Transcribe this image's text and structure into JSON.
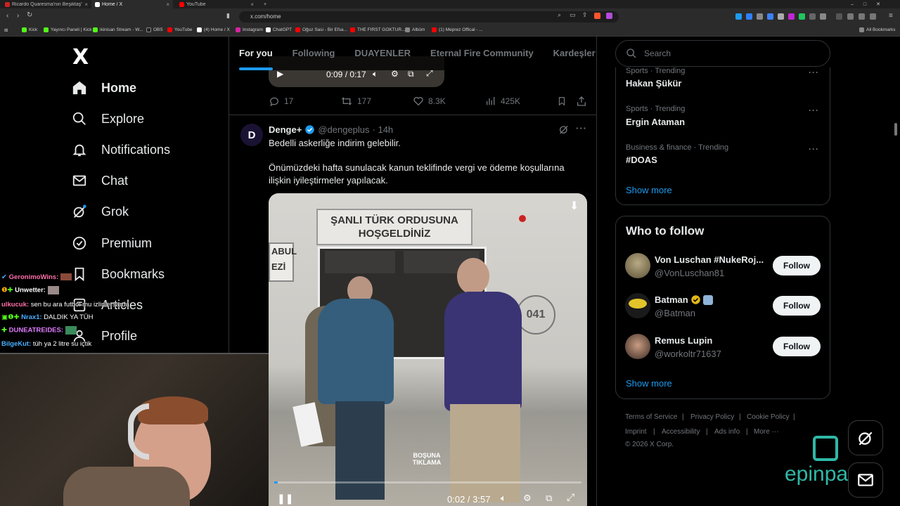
{
  "browser": {
    "tabs": [
      {
        "label": "Ricardo Quaresma'nın Beşiktaş'taki T",
        "color": "#cc2222"
      },
      {
        "label": "Home / X",
        "color": "#ffffff"
      },
      {
        "label": "YouTube",
        "color": "#ff0000"
      }
    ],
    "new_tab": "+",
    "url": "x.com/home",
    "bookmarks": [
      {
        "label": "Kick",
        "color": "#53fc18"
      },
      {
        "label": "Yayıncı Paneli | Kick",
        "color": "#53fc18"
      },
      {
        "label": "ikinisan Stream - W...",
        "color": "#53fc18"
      },
      {
        "label": "OBS",
        "color": "#222222"
      },
      {
        "label": "YouTube",
        "color": "#ff0000"
      },
      {
        "label": "(4) Home / X",
        "color": "#ffffff"
      },
      {
        "label": "Instagram",
        "color": "#d6249f"
      },
      {
        "label": "ChatGPT",
        "color": "#ffffff"
      },
      {
        "label": "Oğuz Sasi - Bir Efsa...",
        "color": "#ff0000"
      },
      {
        "label": "THE FIRST GOKTUR...",
        "color": "#ff0000"
      },
      {
        "label": "Albüm",
        "color": "#888888"
      },
      {
        "label": "(1) Meprez Offical - ...",
        "color": "#ff0000"
      }
    ],
    "all_bookmarks": "All Bookmarks"
  },
  "sidebar": {
    "logo": "X",
    "items": [
      {
        "label": "Home",
        "icon": "home-icon"
      },
      {
        "label": "Explore",
        "icon": "search-icon"
      },
      {
        "label": "Notifications",
        "icon": "bell-icon"
      },
      {
        "label": "Chat",
        "icon": "mail-icon"
      },
      {
        "label": "Grok",
        "icon": "grok-icon"
      },
      {
        "label": "Premium",
        "icon": "premium-icon"
      },
      {
        "label": "Bookmarks",
        "icon": "bookmark-icon"
      },
      {
        "label": "Articles",
        "icon": "article-icon"
      },
      {
        "label": "Profile",
        "icon": "profile-icon"
      }
    ]
  },
  "feed": {
    "tabs": [
      "For you",
      "Following",
      "DUAYENLER",
      "Eternal Fire Community",
      "Kardeşler K"
    ],
    "post1": {
      "video_time": "0:09 / 0:17",
      "replies": "17",
      "reposts": "177",
      "likes": "8.3K",
      "views": "425K"
    },
    "post2": {
      "author": "Denge+",
      "handle": "@dengeplus",
      "time": "· 14h",
      "text1": "Bedelli askerliğe indirim gelebilir.",
      "text2": "Önümüzdeki hafta sunulacak kanun teklifinde vergi ve ödeme koşullarına ilişkin iyileştirmeler yapılacak.",
      "sign_line1": "ŞANLI TÜRK ORDUSUNA",
      "sign_line2": "HOŞGELDİNİZ",
      "side_sign": "ABUL\nEZİ",
      "door_number": "041",
      "watermark": "BOŞUNA TIKLAMA",
      "video_time": "0:02 / 3:57"
    }
  },
  "right": {
    "search_placeholder": "Search",
    "trends": [
      {
        "category": "Sports · Trending",
        "name": "Hakan Şükür"
      },
      {
        "category": "Sports · Trending",
        "name": "Ergin Ataman"
      },
      {
        "category": "Business & finance · Trending",
        "name": "#DOAS"
      }
    ],
    "show_more": "Show more",
    "who_to_follow_title": "Who to follow",
    "follow_suggestions": [
      {
        "name": "Von Luschan #NukeRoj...",
        "handle": "@VonLuschan81",
        "button": "Follow"
      },
      {
        "name": "Batman",
        "handle": "@Batman",
        "button": "Follow"
      },
      {
        "name": "Remus Lupin",
        "handle": "@workoltr71637",
        "button": "Follow"
      }
    ],
    "footer": {
      "terms": "Terms of Service",
      "privacy": "Privacy Policy",
      "cookie": "Cookie Policy",
      "imprint": "Imprint",
      "accessibility": "Accessibility",
      "ads": "Ads info",
      "more": "More ···",
      "copyright": "© 2026 X Corp."
    }
  },
  "stream_chat": [
    {
      "user": "GeronimoWins:",
      "color": "#ff6fa8",
      "msg": ""
    },
    {
      "user": "Unwetter:",
      "color": "#ffffff",
      "msg": ""
    },
    {
      "user": "ulkucuk:",
      "color": "#ff6fa8",
      "msg": " sen bu ara futbol mu izlinlersarda"
    },
    {
      "user": "Nrax1:",
      "color": "#4ab0ff",
      "msg": " DALDIK YA TÜH"
    },
    {
      "user": "DUNEATREIDES:",
      "color": "#e07bff",
      "msg": ""
    },
    {
      "user": "BilgeKut:",
      "color": "#4ab0ff",
      "msg": " tüh ya 2 litre su içtik"
    }
  ],
  "overlay": {
    "brand": "epinpay"
  }
}
